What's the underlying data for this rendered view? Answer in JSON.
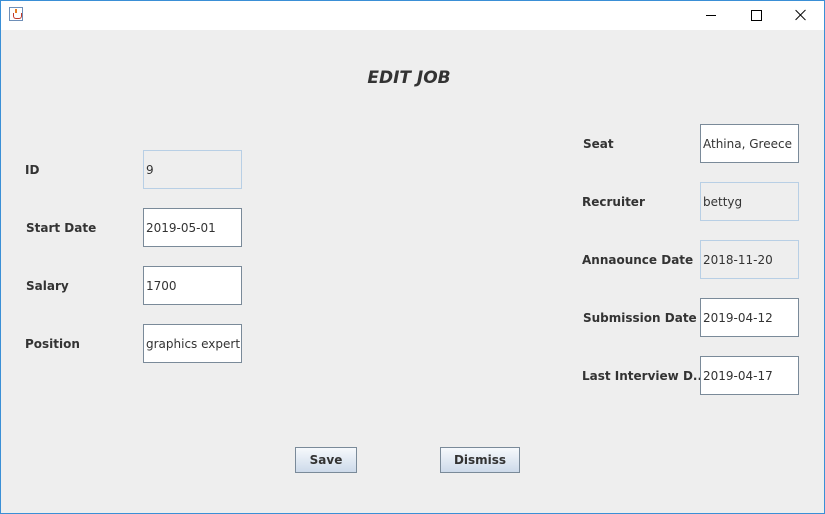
{
  "window": {
    "title": ""
  },
  "header": {
    "title": "EDIT JOB"
  },
  "left_fields": {
    "id": {
      "label": "ID",
      "value": "9"
    },
    "start_date": {
      "label": "Start Date",
      "value": "2019-05-01"
    },
    "salary": {
      "label": "Salary",
      "value": "1700"
    },
    "position": {
      "label": "Position",
      "value": "graphics expert"
    }
  },
  "right_fields": {
    "seat": {
      "label": "Seat",
      "value": "Athina, Greece"
    },
    "recruiter": {
      "label": "Recruiter",
      "value": "bettyg"
    },
    "announce_date": {
      "label": "Annaounce Date",
      "value": "2018-11-20"
    },
    "submission_date": {
      "label": "Submission Date",
      "value": "2019-04-12"
    },
    "last_interview_date": {
      "label": "Last Interview D...",
      "value": "2019-04-17"
    }
  },
  "buttons": {
    "save": "Save",
    "dismiss": "Dismiss"
  }
}
